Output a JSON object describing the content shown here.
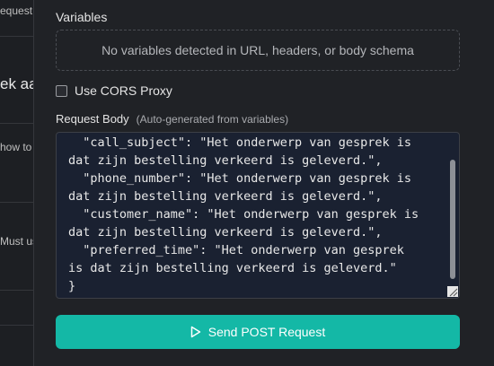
{
  "left_panel": {
    "fragments": [
      "equest.",
      "ek aan",
      "how to",
      "Must us"
    ]
  },
  "variables": {
    "label": "Variables",
    "empty_message": "No variables detected in URL, headers, or body schema"
  },
  "cors": {
    "label": "Use CORS Proxy",
    "checked": false
  },
  "request_body": {
    "label": "Request Body",
    "hint": "(Auto-generated from variables)",
    "code": "  \"call_subject\": \"Het onderwerp van gesprek is\ndat zijn bestelling verkeerd is geleverd.\",\n  \"phone_number\": \"Het onderwerp van gesprek is\ndat zijn bestelling verkeerd is geleverd.\",\n  \"customer_name\": \"Het onderwerp van gesprek is\ndat zijn bestelling verkeerd is geleverd.\",\n  \"preferred_time\": \"Het onderwerp van gesprek\nis dat zijn bestelling verkeerd is geleverd.\"\n}"
  },
  "send_button": {
    "label": "Send POST Request",
    "icon": "play-icon",
    "color": "#14b8a6"
  }
}
